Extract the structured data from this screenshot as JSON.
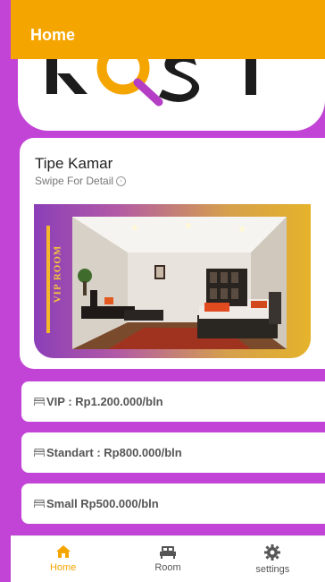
{
  "header": {
    "title": "Home"
  },
  "logo": {
    "text": "ROST"
  },
  "room_type": {
    "title": "Tipe Kamar",
    "subtitle": "Swipe For Detail",
    "banner_label": "VIP ROOM"
  },
  "prices": [
    {
      "label": "VIP : Rp1.200.000/bln"
    },
    {
      "label": "Standart : Rp800.000/bln"
    },
    {
      "label": "Small Rp500.000/bln"
    }
  ],
  "nav": [
    {
      "label": "Home",
      "icon": "home-icon",
      "active": true
    },
    {
      "label": "Room",
      "icon": "bed-icon",
      "active": false
    },
    {
      "label": "settings",
      "icon": "gear-icon",
      "active": false
    }
  ],
  "colors": {
    "primary": "#f5a500",
    "background": "#c244d6",
    "card": "#ffffff"
  }
}
